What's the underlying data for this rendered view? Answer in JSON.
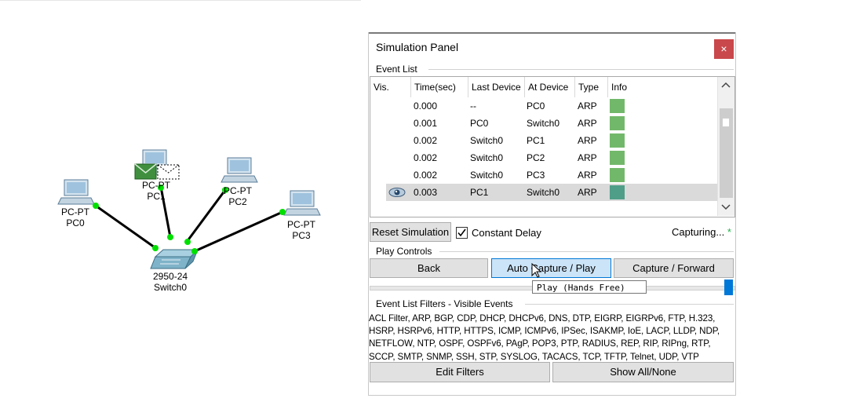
{
  "topology": {
    "devices": [
      {
        "type": "PC-PT",
        "name": "PC0"
      },
      {
        "type": "PC-PT",
        "name": "PC1"
      },
      {
        "type": "PC-PT",
        "name": "PC2"
      },
      {
        "type": "PC-PT",
        "name": "PC3"
      },
      {
        "type": "2950-24",
        "name": "Switch0"
      }
    ],
    "link_light_color": "#00e000"
  },
  "panel": {
    "title": "Simulation Panel",
    "close_label": "×",
    "event_list": {
      "label": "Event List",
      "columns": [
        "Vis.",
        "Time(sec)",
        "Last Device",
        "At Device",
        "Type",
        "Info"
      ],
      "rows": [
        {
          "time": "0.000",
          "last": "--",
          "at": "PC0",
          "type": "ARP",
          "info_color": "#72b86a",
          "visible_icon": false
        },
        {
          "time": "0.001",
          "last": "PC0",
          "at": "Switch0",
          "type": "ARP",
          "info_color": "#72b86a",
          "visible_icon": false
        },
        {
          "time": "0.002",
          "last": "Switch0",
          "at": "PC1",
          "type": "ARP",
          "info_color": "#72b86a",
          "visible_icon": false
        },
        {
          "time": "0.002",
          "last": "Switch0",
          "at": "PC2",
          "type": "ARP",
          "info_color": "#72b86a",
          "visible_icon": false
        },
        {
          "time": "0.002",
          "last": "Switch0",
          "at": "PC3",
          "type": "ARP",
          "info_color": "#72b86a",
          "visible_icon": false
        },
        {
          "time": "0.003",
          "last": "PC1",
          "at": "Switch0",
          "type": "ARP",
          "info_color": "#4f9e87",
          "visible_icon": true,
          "selected": true
        }
      ]
    },
    "reset_label": "Reset Simulation",
    "constant_delay": {
      "label": "Constant Delay",
      "checked": true
    },
    "status": {
      "text": "Capturing...",
      "star": "*"
    },
    "play_controls": {
      "label": "Play Controls",
      "back": "Back",
      "auto": "Auto Capture / Play",
      "forward": "Capture / Forward",
      "speed_level": 1.0,
      "tooltip": "Play (Hands Free)"
    },
    "filters": {
      "label": "Event List Filters - Visible Events",
      "lines": [
        "ACL Filter, ARP, BGP, CDP, DHCP, DHCPv6, DNS, DTP, EIGRP, EIGRPv6, FTP, H.323,",
        "HSRP, HSRPv6, HTTP, HTTPS, ICMP, ICMPv6, IPSec, ISAKMP, IoE, LACP, LLDP, NDP,",
        "NETFLOW, NTP, OSPF, OSPFv6, PAgP, POP3, PTP, RADIUS, REP, RIP, RIPng, RTP,",
        "SCCP, SMTP, SNMP, SSH, STP, SYSLOG, TACACS, TCP, TFTP, Telnet, UDP, VTP"
      ],
      "edit": "Edit Filters",
      "show_all": "Show All/None"
    }
  }
}
